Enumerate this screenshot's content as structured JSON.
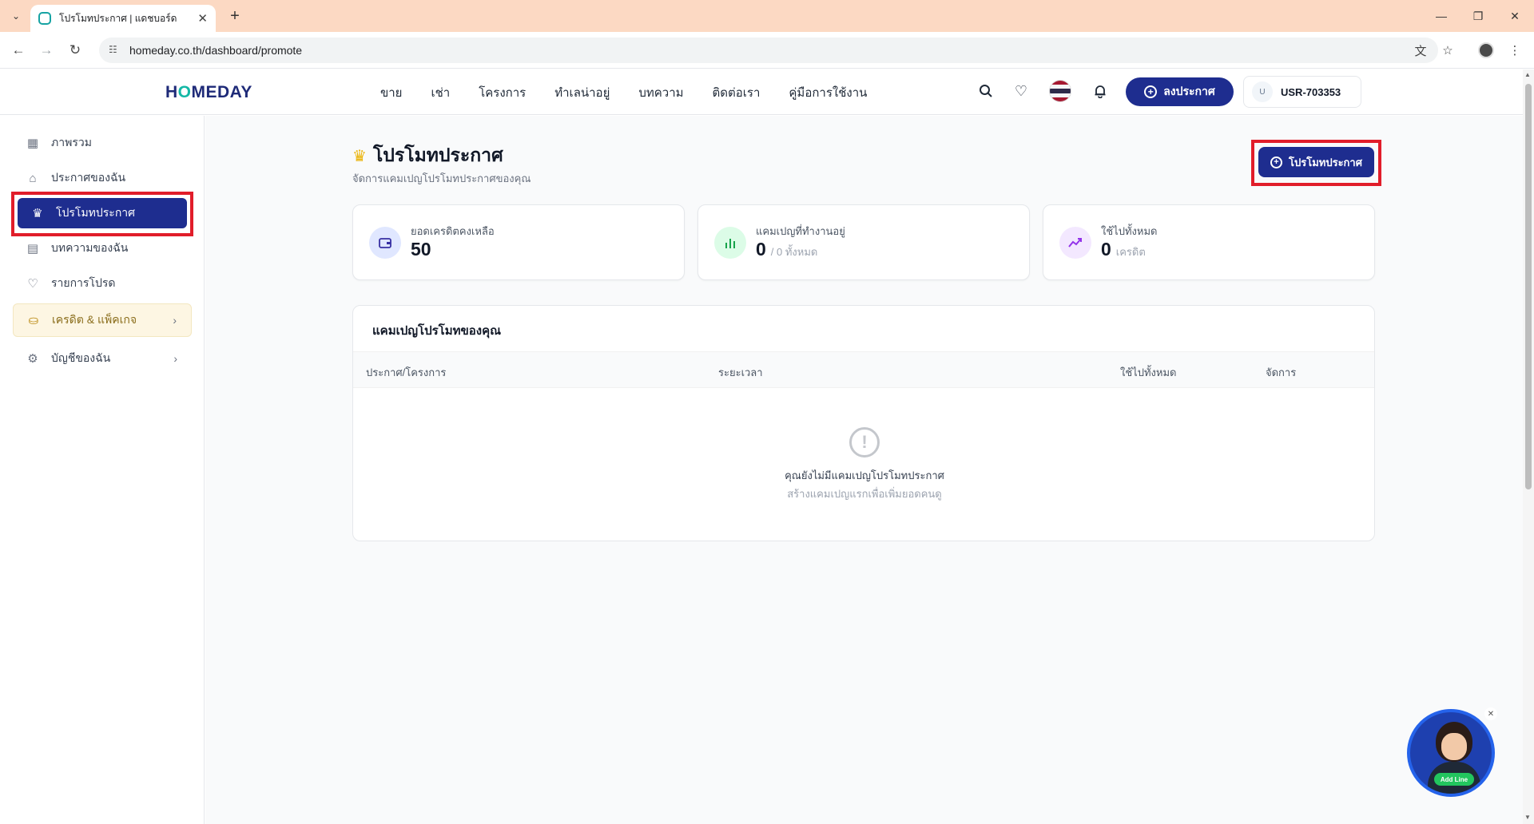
{
  "browser": {
    "tab_title": "โปรโมทประกาศ | แดชบอร์ด",
    "url": "homeday.co.th/dashboard/promote"
  },
  "header": {
    "logo_text": "HOMEDAY",
    "nav": [
      "ขาย",
      "เช่า",
      "โครงการ",
      "ทำเลน่าอยู่",
      "บทความ",
      "ติดต่อเรา",
      "คู่มือการใช้งาน"
    ],
    "post_button": "ลงประกาศ",
    "user_avatar": "U",
    "user_id": "USR-703353"
  },
  "sidebar": {
    "items": [
      {
        "label": "ภาพรวม",
        "icon": "grid-icon"
      },
      {
        "label": "ประกาศของฉัน",
        "icon": "home-icon"
      },
      {
        "label": "โปรโมทประกาศ",
        "icon": "crown-icon"
      },
      {
        "label": "บทความของฉัน",
        "icon": "document-icon"
      },
      {
        "label": "รายการโปรด",
        "icon": "heart-icon"
      },
      {
        "label": "เครดิต & แพ็คเกจ",
        "icon": "coins-icon"
      },
      {
        "label": "บัญชีของฉัน",
        "icon": "gear-icon"
      }
    ],
    "active_index": 2
  },
  "page": {
    "title": "โปรโมทประกาศ",
    "subtitle": "จัดการแคมเปญโปรโมทประกาศของคุณ",
    "promote_button": "โปรโมทประกาศ"
  },
  "stats": [
    {
      "label": "ยอดเครดิตคงเหลือ",
      "value": "50",
      "unit": "",
      "icon": "wallet-icon",
      "color": "#e0e7ff"
    },
    {
      "label": "แคมเปญที่ทำงานอยู่",
      "value": "0",
      "unit": "/ 0 ทั้งหมด",
      "icon": "bar-chart-icon",
      "color": "#dcfce7"
    },
    {
      "label": "ใช้ไปทั้งหมด",
      "value": "0",
      "unit": "เครดิต",
      "icon": "trending-up-icon",
      "color": "#f3e8ff"
    }
  ],
  "campaigns": {
    "title": "แคมเปญโปรโมทของคุณ",
    "columns": [
      "ประกาศ/โครงการ",
      "ระยะเวลา",
      "ใช้ไปทั้งหมด",
      "จัดการ"
    ],
    "empty_title": "คุณยังไม่มีแคมเปญโปรโมทประกาศ",
    "empty_subtitle": "สร้างแคมเปญแรกเพื่อเพิ่มยอดคนดู"
  },
  "line_widget": {
    "badge": "Add Line"
  },
  "colors": {
    "brand": "#1e2d8f",
    "accent": "#14b8a6",
    "highlight": "#e11d2a"
  }
}
